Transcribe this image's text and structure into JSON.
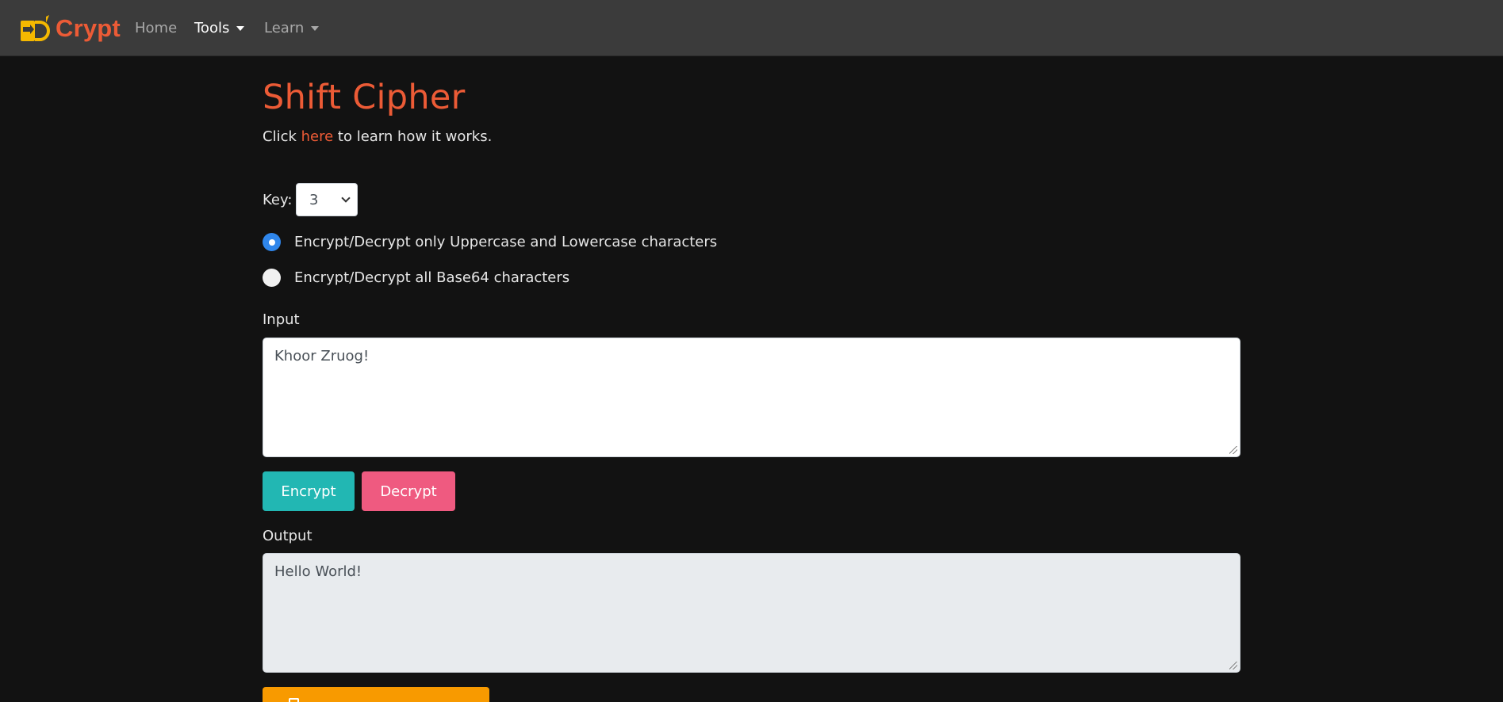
{
  "navbar": {
    "brand": "Crypt",
    "logo_icon": "dcrypt-logo-icon",
    "links": [
      {
        "label": "Home",
        "active": false,
        "dropdown": false
      },
      {
        "label": "Tools",
        "active": true,
        "dropdown": true
      },
      {
        "label": "Learn",
        "active": false,
        "dropdown": true
      }
    ]
  },
  "page": {
    "title": "Shift Cipher",
    "intro_before": "Click ",
    "intro_link": "here",
    "intro_after": " to learn how it works."
  },
  "key": {
    "label": "Key:",
    "value": "3"
  },
  "options": [
    {
      "label": "Encrypt/Decrypt only Uppercase and Lowercase characters",
      "checked": true
    },
    {
      "label": "Encrypt/Decrypt all Base64 characters",
      "checked": false
    }
  ],
  "input": {
    "label": "Input",
    "value": "Khoor Zruog!"
  },
  "buttons": {
    "encrypt": "Encrypt",
    "decrypt": "Decrypt",
    "copy_icon": "clipboard-icon"
  },
  "output": {
    "label": "Output",
    "value": "Hello World!"
  },
  "colors": {
    "accent": "#ec5b36",
    "encrypt": "#22b7b3",
    "decrypt": "#ef5a80",
    "copy": "#f89a00",
    "radio_checked": "#2f86eb"
  }
}
